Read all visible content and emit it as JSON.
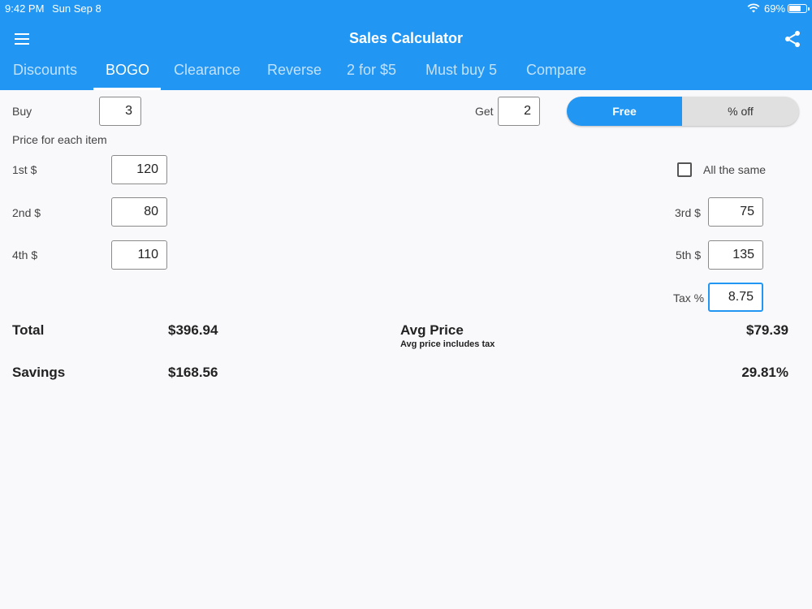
{
  "status": {
    "time": "9:42 PM",
    "date": "Sun Sep 8",
    "battery_pct": "69%",
    "battery_level": 0.69
  },
  "header": {
    "title": "Sales Calculator"
  },
  "tabs": [
    {
      "label": "Discounts"
    },
    {
      "label": "BOGO"
    },
    {
      "label": "Clearance"
    },
    {
      "label": "Reverse"
    },
    {
      "label": "2 for $5"
    },
    {
      "label": "Must buy 5"
    },
    {
      "label": "Compare"
    }
  ],
  "active_tab": "BOGO",
  "form": {
    "buy_label": "Buy",
    "buy_value": "3",
    "get_label": "Get",
    "get_value": "2",
    "mode_free": "Free",
    "mode_pct": "% off",
    "price_heading": "Price for each item",
    "all_same_label": "All the same",
    "first_label": "1st $",
    "first_value": "120",
    "second_label": "2nd $",
    "second_value": "80",
    "third_label": "3rd $",
    "third_value": "75",
    "fourth_label": "4th $",
    "fourth_value": "110",
    "fifth_label": "5th $",
    "fifth_value": "135",
    "tax_label": "Tax %",
    "tax_value": "8.75"
  },
  "results": {
    "total_label": "Total",
    "total_value": "$396.94",
    "avg_label": "Avg Price",
    "avg_value": "$79.39",
    "avg_note": "Avg price includes tax",
    "savings_label": "Savings",
    "savings_value": "$168.56",
    "savings_pct": "29.81%"
  },
  "colors": {
    "primary": "#2196f3",
    "background": "#f9f9fb"
  }
}
